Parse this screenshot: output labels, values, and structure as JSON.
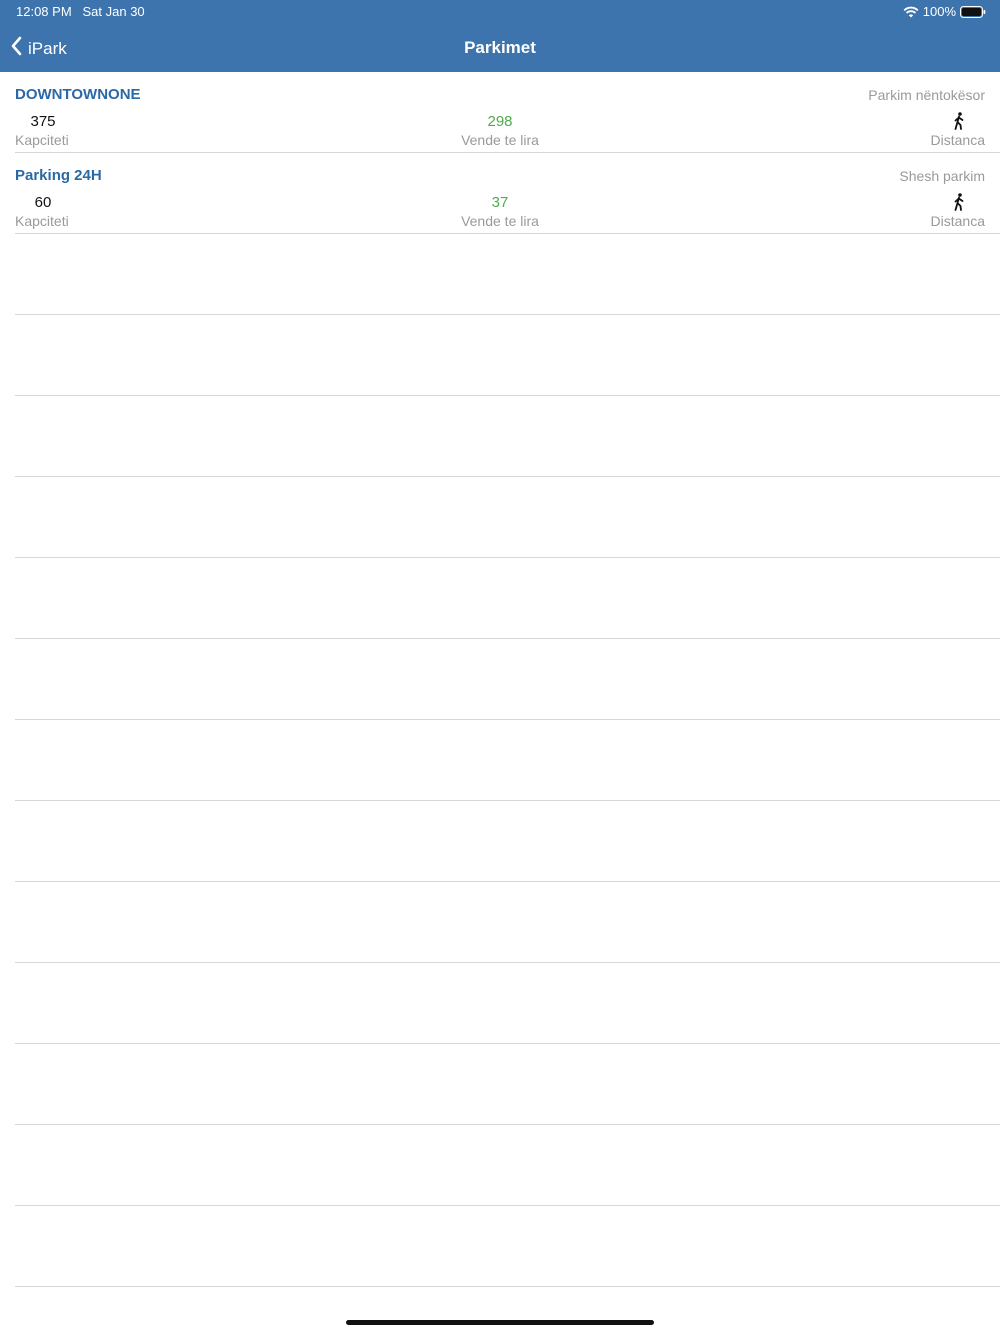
{
  "status_bar": {
    "time": "12:08 PM",
    "date": "Sat Jan 30",
    "battery": "100%",
    "icons": [
      "wifi-icon",
      "battery-icon"
    ]
  },
  "nav": {
    "back_label": "iPark",
    "title": "Parkimet",
    "back_icon": "chevron-left-icon"
  },
  "parkings": [
    {
      "name": "DOWNTOWNONE",
      "type": "Parkim nëntokësor",
      "capacity": "375",
      "capacity_label": "Kapciteti",
      "free": "298",
      "free_label": "Vende te lira",
      "distance_label": "Distanca",
      "distance_icon": "walking-person-icon"
    },
    {
      "name": "Parking 24H",
      "type": "Shesh parkim",
      "capacity": "60",
      "capacity_label": "Kapciteti",
      "free": "37",
      "free_label": "Vende te lira",
      "distance_label": "Distanca",
      "distance_icon": "walking-person-icon"
    }
  ],
  "colors": {
    "header": "#3e74ad",
    "name": "#2b69a6",
    "free": "#4fac4f",
    "secondary_text": "#9a9a9a"
  }
}
